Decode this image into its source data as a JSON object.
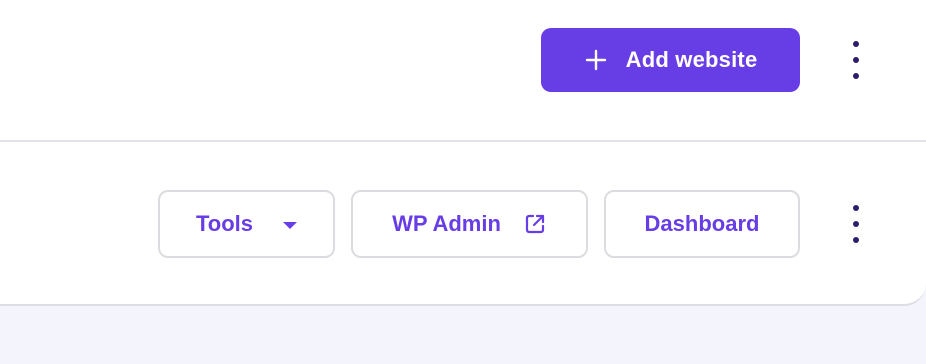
{
  "header": {
    "add_website_label": "Add website",
    "add_icon": "plus-icon",
    "more_icon": "kebab-vertical-icon"
  },
  "website_card": {
    "tools_label": "Tools",
    "tools_icon": "caret-down-icon",
    "wp_admin_label": "WP Admin",
    "wp_admin_icon": "external-link-icon",
    "dashboard_label": "Dashboard",
    "more_icon": "kebab-vertical-icon"
  },
  "colors": {
    "primary": "#673de6",
    "dark_icon": "#2f1c6a",
    "page_background": "#f4f4fc",
    "border": "#dadce0"
  }
}
